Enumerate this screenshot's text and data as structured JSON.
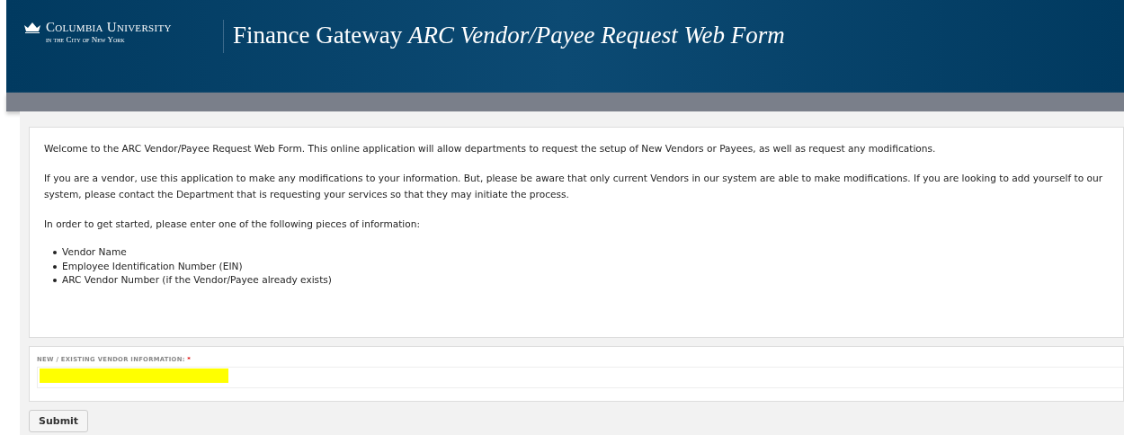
{
  "header": {
    "university": "Columbia University",
    "university_sub": "in the City of New York",
    "title": "Finance Gateway",
    "subtitle": "ARC Vendor/Payee Request Web Form"
  },
  "intro": {
    "paragraphs": [
      "Welcome to the ARC Vendor/Payee Request Web Form. This online application will allow departments to request the setup of New Vendors or Payees, as well as request any modifications.",
      "If you are a vendor, use this application to make any modifications to your information. But, please be aware that only current Vendors in our system are able to make modifications. If you are looking to add yourself to our system, please contact the Department that is requesting your services so that they may initiate the process.",
      "In order to get started, please enter one of the following pieces of information:"
    ],
    "list": [
      "Vendor Name",
      "Employee Identification Number (EIN)",
      "ARC Vendor Number (if the Vendor/Payee already exists)"
    ]
  },
  "field": {
    "label": "NEW / EXISTING VENDOR INFORMATION:",
    "required_mark": "*",
    "redacted": true
  },
  "buttons": [
    "Submit"
  ]
}
